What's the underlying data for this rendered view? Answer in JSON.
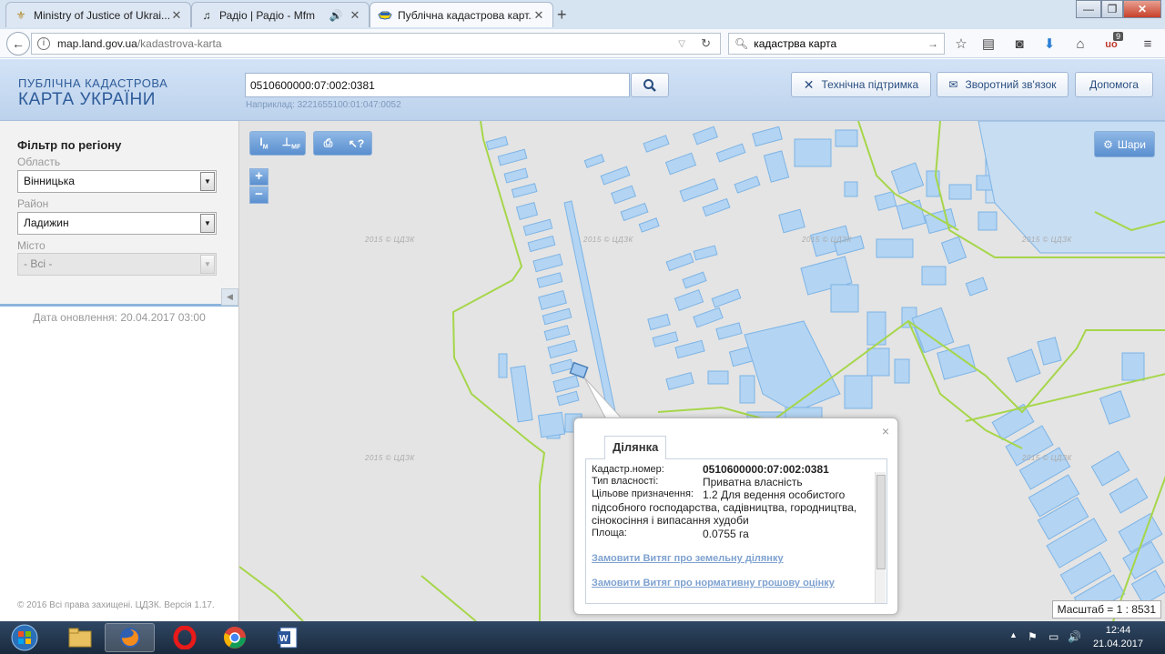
{
  "browser": {
    "tabs": [
      {
        "title": "Ministry of Justice of Ukrai...",
        "favicon": "emblem-icon"
      },
      {
        "title": "Радіо | Радіо - Mfm",
        "favicon": "music-icon"
      },
      {
        "title": "Публічна кадастрова карт...",
        "favicon": "ukraine-map-icon"
      }
    ],
    "new_tab": "+",
    "window_controls": {
      "minimize": "—",
      "maximize": "❐",
      "close": "✕"
    },
    "url_host": "map.land.gov.ua",
    "url_path": "/kadastrova-karta",
    "search_value": "кадастрва карта",
    "addon_badge": "9"
  },
  "site": {
    "logo_line1": "ПУБЛІЧНА КАДАСТРОВА",
    "logo_line2": "КАРТА УКРАЇНИ",
    "search_value": "0510600000:07:002:0381",
    "example": "Наприклад: 3221655100:01:047:0052",
    "buttons": {
      "support": "Технічна підтримка",
      "feedback": "Зворотний зв'язок",
      "help": "Допомога"
    }
  },
  "sidebar": {
    "title": "Фільтр по регіону",
    "oblast_label": "Область",
    "oblast_value": "Вінницька",
    "rayon_label": "Район",
    "rayon_value": "Ладижин",
    "city_label": "Місто",
    "city_value": "- Всі -",
    "updated": "Дата оновлення: 20.04.2017 03:00",
    "copyright": "© 2016 Всі права захищені. ЦДЗК. Версія 1.17."
  },
  "map": {
    "tools": {
      "measure_m": "M",
      "measure_mf": "MF",
      "print": "print-icon",
      "identify": "identify-icon"
    },
    "zoom_in": "+",
    "zoom_out": "−",
    "layers_label": "Шари",
    "scale": "Масштаб = 1 : 8531",
    "watermark": "2015 © ЦДЗК"
  },
  "popup": {
    "tab": "Ділянка",
    "close": "×",
    "rows": [
      {
        "label": "Кадастр.номер:",
        "value": "0510600000:07:002:0381"
      },
      {
        "label": "Тип власності:",
        "value": "Приватна власність"
      },
      {
        "label": "Цільове призначення:",
        "value": "1.2 Для ведення особистого"
      },
      {
        "label": "",
        "value": "підсобного господарства, садівництва, городництва,"
      },
      {
        "label": "",
        "value": "сінокосіння і випасання худоби"
      },
      {
        "label": "Площа:",
        "value": "0.0755 га"
      }
    ],
    "links": [
      "Замовити Витяг про земельну ділянку",
      "Замовити Витяг про нормативну грошову оцінку"
    ]
  },
  "taskbar": {
    "time": "12:44",
    "date": "21.04.2017",
    "apps": [
      "start-icon",
      "file-explorer-icon",
      "firefox-icon",
      "opera-icon",
      "chrome-icon",
      "word-icon"
    ]
  },
  "colors": {
    "accent": "#2e5c9a",
    "parcel_fill": "#b3d4f2",
    "parcel_stroke": "#7db4e6",
    "boundary": "#a6d64a"
  }
}
